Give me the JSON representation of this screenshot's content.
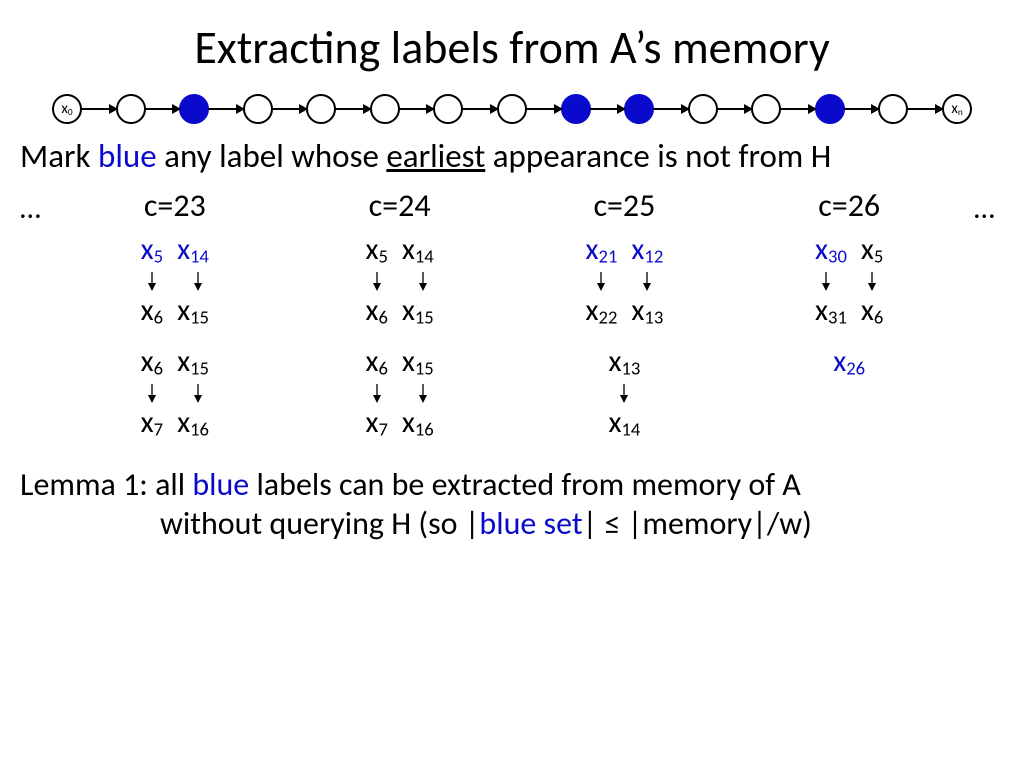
{
  "title": "Extracting labels from A’s memory",
  "chain": {
    "nodes": [
      {
        "label": "x0",
        "filled": false
      },
      {
        "label": "",
        "filled": false
      },
      {
        "label": "",
        "filled": true
      },
      {
        "label": "",
        "filled": false
      },
      {
        "label": "",
        "filled": false
      },
      {
        "label": "",
        "filled": false
      },
      {
        "label": "",
        "filled": false
      },
      {
        "label": "",
        "filled": false
      },
      {
        "label": "",
        "filled": true
      },
      {
        "label": "",
        "filled": true
      },
      {
        "label": "",
        "filled": false
      },
      {
        "label": "",
        "filled": false
      },
      {
        "label": "",
        "filled": true
      },
      {
        "label": "",
        "filled": false
      },
      {
        "label": "xn",
        "filled": false
      }
    ]
  },
  "mark": {
    "prefix": "Mark ",
    "blue": "blue",
    "mid": " any label whose ",
    "earliest": "earliest",
    "suffix": " appearance is not from H"
  },
  "ellipsis": "…",
  "cols": [
    {
      "header": "c=23",
      "top": [
        {
          "v": "x",
          "s": "5",
          "blue": true
        },
        {
          "v": "x",
          "s": "14",
          "blue": true
        }
      ],
      "topTo": [
        {
          "v": "x",
          "s": "6"
        },
        {
          "v": "x",
          "s": "15"
        }
      ],
      "bot": [
        {
          "v": "x",
          "s": "6"
        },
        {
          "v": "x",
          "s": "15"
        }
      ],
      "botTo": [
        {
          "v": "x",
          "s": "7"
        },
        {
          "v": "x",
          "s": "16"
        }
      ]
    },
    {
      "header": "c=24",
      "top": [
        {
          "v": "x",
          "s": "5"
        },
        {
          "v": "x",
          "s": "14"
        }
      ],
      "topTo": [
        {
          "v": "x",
          "s": "6"
        },
        {
          "v": "x",
          "s": "15"
        }
      ],
      "bot": [
        {
          "v": "x",
          "s": "6"
        },
        {
          "v": "x",
          "s": "15"
        }
      ],
      "botTo": [
        {
          "v": "x",
          "s": "7"
        },
        {
          "v": "x",
          "s": "16"
        }
      ]
    },
    {
      "header": "c=25",
      "top": [
        {
          "v": "x",
          "s": "21",
          "blue": true
        },
        {
          "v": "x",
          "s": "12",
          "blue": true
        }
      ],
      "topTo": [
        {
          "v": "x",
          "s": "22"
        },
        {
          "v": "x",
          "s": "13"
        }
      ],
      "bot": [
        {
          "v": "x",
          "s": "13"
        }
      ],
      "botTo": [
        {
          "v": "x",
          "s": "14"
        }
      ]
    },
    {
      "header": "c=26",
      "top": [
        {
          "v": "x",
          "s": "30",
          "blue": true
        },
        {
          "v": "x",
          "s": "5"
        }
      ],
      "topTo": [
        {
          "v": "x",
          "s": "31"
        },
        {
          "v": "x",
          "s": "6"
        }
      ],
      "single": {
        "v": "x",
        "s": "26",
        "blue": true
      }
    }
  ],
  "lemma": {
    "prefix": "Lemma 1: all ",
    "blue1": "blue",
    "mid1": " labels can be extracted from memory of A",
    "line2a": "without querying H (so |",
    "blue2": "blue set",
    "line2b": "| ≤ |memory|/w)"
  }
}
